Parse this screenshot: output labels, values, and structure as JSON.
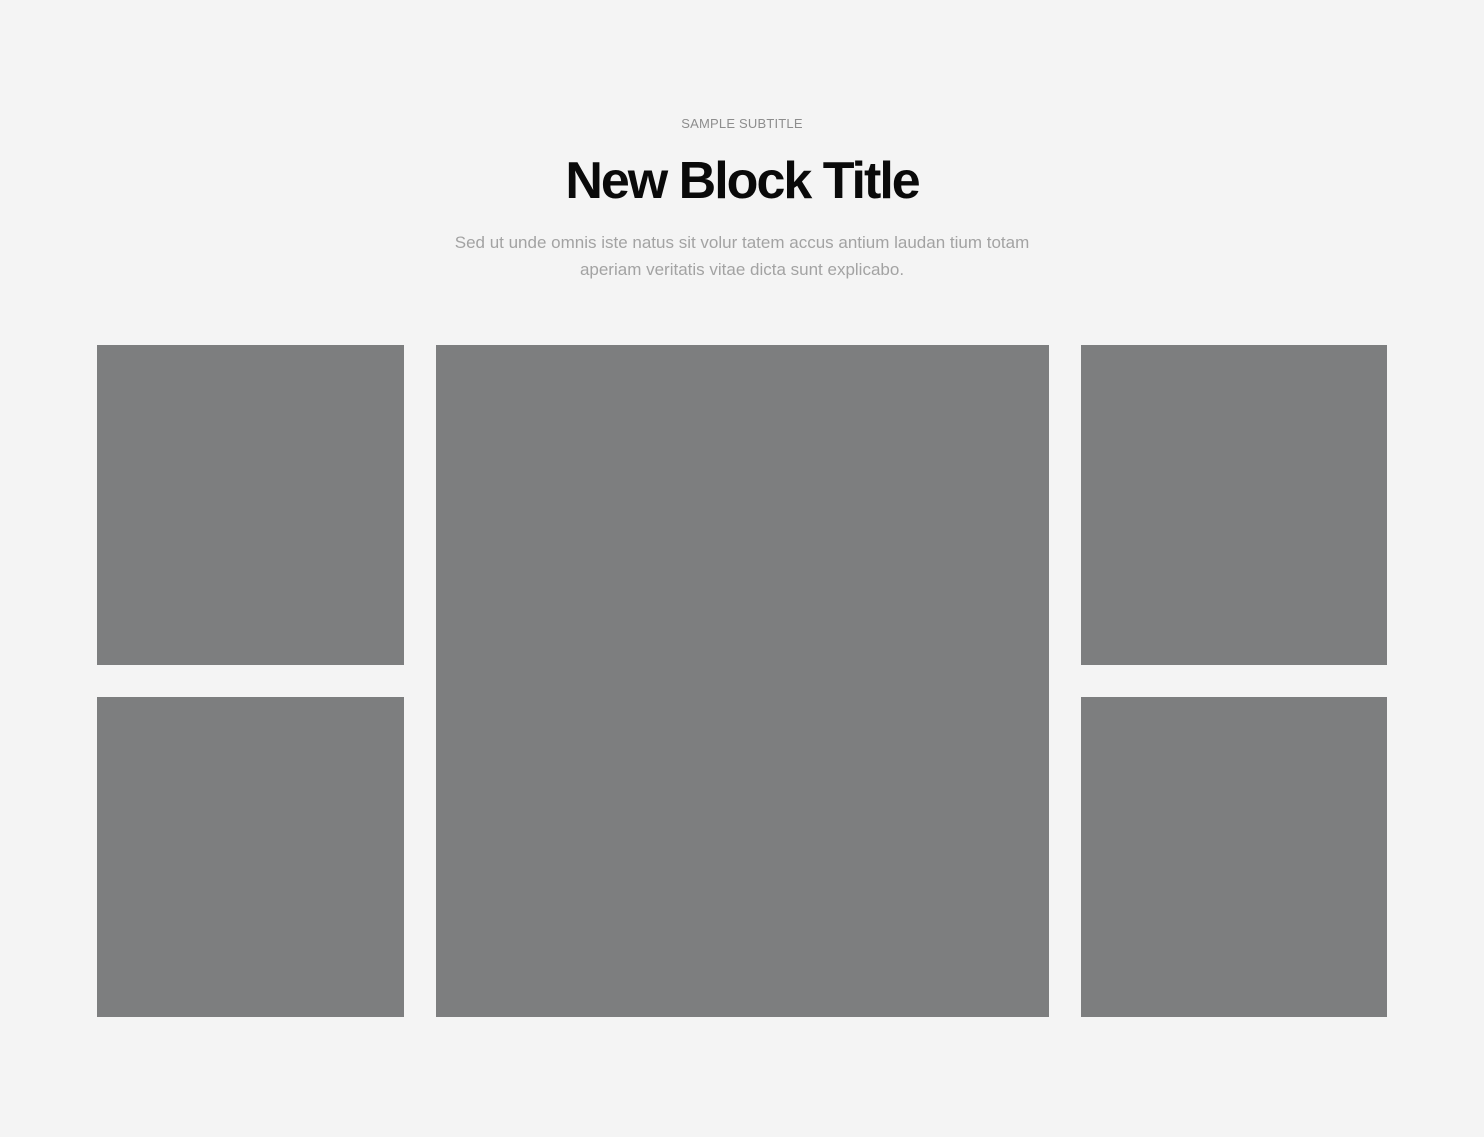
{
  "block": {
    "subtitle": "SAMPLE SUBTITLE",
    "title": "New Block Title",
    "description": "Sed ut unde omnis iste natus sit volur tatem accus antium laudan tium totam aperiam veritatis vitae dicta sunt explicabo."
  },
  "colors": {
    "background": "#f4f4f4",
    "image_placeholder": "#7d7e7f",
    "title": "#0a0a0a",
    "muted_text": "#a3a3a3"
  }
}
